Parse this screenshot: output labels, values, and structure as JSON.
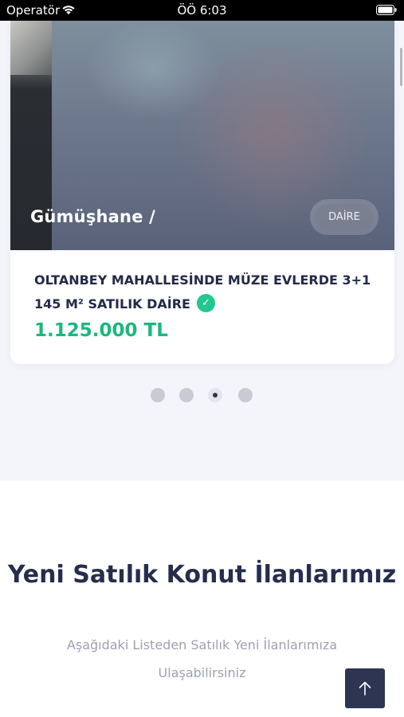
{
  "status_bar": {
    "carrier": "Operatör",
    "time": "ÖÖ 6:03",
    "wifi_icon": "wifi-icon",
    "battery_icon": "battery-icon"
  },
  "listing": {
    "location": "Gümüşhane /",
    "type_badge": "DAİRE",
    "title": "OLTANBEY MAHALLESİNDE MÜZE EVLERDE 3+1 145 M² SATILIK DAİRE",
    "verified_icon": "check-circle-icon",
    "price": "1.125.000 TL"
  },
  "pagination": {
    "total": 4,
    "active_index": 2
  },
  "section": {
    "title": "Yeni Satılık Konut İlanlarımız",
    "subtitle": "Aşağıdaki Listeden Satılık Yeni İlanlarımıza Ulaşabilirsiniz"
  },
  "back_to_top": {
    "icon": "arrow-up-icon"
  },
  "colors": {
    "accent_green": "#17b97c",
    "navy": "#2d3552",
    "verified": "#22c88d"
  }
}
